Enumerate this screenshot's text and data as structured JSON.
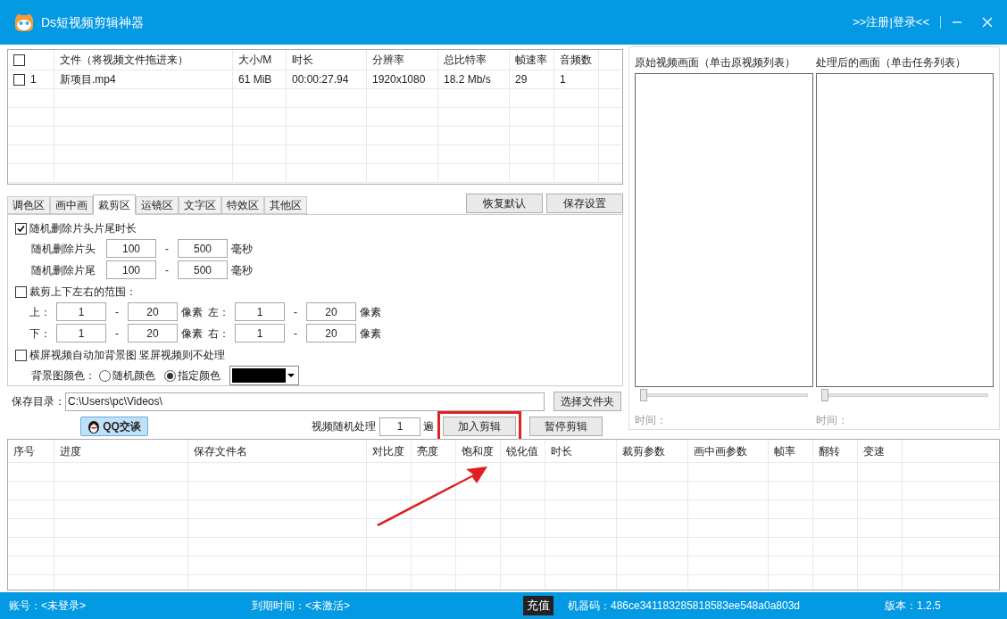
{
  "window": {
    "title": "Ds短视频剪辑神器",
    "login_link": ">>注册|登录<<"
  },
  "file_table": {
    "header_checked": false,
    "columns": [
      "文件（将视频文件拖进来）",
      "大小/M",
      "时长",
      "分辨率",
      "总比特率",
      "帧速率",
      "音频数"
    ],
    "rows": [
      {
        "checked": false,
        "index": "1",
        "cells": [
          "新项目.mp4",
          "61 MiB",
          "00:00:27.94",
          "1920x1080",
          "18.2 Mb/s",
          "29",
          "1"
        ]
      }
    ]
  },
  "tabs": [
    {
      "label": "调色区",
      "selected": false
    },
    {
      "label": "画中画",
      "selected": false
    },
    {
      "label": "裁剪区",
      "selected": true
    },
    {
      "label": "运镜区",
      "selected": false
    },
    {
      "label": "文字区",
      "selected": false
    },
    {
      "label": "特效区",
      "selected": false
    },
    {
      "label": "其他区",
      "selected": false
    }
  ],
  "tab_buttons": [
    "恢复默认",
    "保存设置"
  ],
  "random_trim": {
    "label": "随机删除片头片尾时长",
    "checked": true,
    "rows": [
      {
        "label": "随机删除片头",
        "from": "100",
        "sep": "-",
        "to": "500",
        "unit": "毫秒"
      },
      {
        "label": "随机删除片尾",
        "from": "100",
        "sep": "-",
        "to": "500",
        "unit": "毫秒"
      }
    ]
  },
  "crop_range": {
    "label": "裁剪上下左右的范围：",
    "checked": false,
    "rows": [
      [
        {
          "label": "上：",
          "from": "1",
          "sep": "-",
          "to": "20",
          "unit": "像素"
        },
        {
          "label": "左：",
          "from": "1",
          "sep": "-",
          "to": "20",
          "unit": "像素"
        }
      ],
      [
        {
          "label": "下：",
          "from": "1",
          "sep": "-",
          "to": "20",
          "unit": "像素"
        },
        {
          "label": "右：",
          "from": "1",
          "sep": "-",
          "to": "20",
          "unit": "像素"
        }
      ]
    ]
  },
  "background": {
    "label": "横屏视频自动加背景图 竖屏视频则不处理",
    "checked": false,
    "color_label": "背景图颜色：",
    "options": [
      {
        "label": "随机颜色",
        "selected": false
      },
      {
        "label": "指定颜色",
        "selected": true
      }
    ]
  },
  "save_dir": {
    "label": "保存目录：",
    "value": "C:\\Users\\pc\\Videos\\",
    "button": "选择文件夹"
  },
  "qq_button": "QQ交谈",
  "random_process": {
    "label": "视频随机处理",
    "value": "1",
    "unit": "遍"
  },
  "actions": [
    {
      "label": "加入剪辑",
      "highlighted": true
    },
    {
      "label": "暂停剪辑",
      "highlighted": false
    }
  ],
  "task_table": {
    "columns": [
      "序号",
      "进度",
      "保存文件名",
      "对比度",
      "亮度",
      "饱和度",
      "锐化值",
      "时长",
      "裁剪参数",
      "画中画参数",
      "帧率",
      "翻转",
      "变速"
    ]
  },
  "previews": [
    {
      "title": "原始视频画面（单击原视频列表）",
      "level": 0,
      "time_label": "时间："
    },
    {
      "title": "处理后的画面（单击任务列表）",
      "level": 0,
      "time_label": "时间："
    }
  ],
  "status_bar": {
    "account": "账号：<未登录>",
    "expiry": "到期时间：<未激活>",
    "recharge": "充值",
    "machine_code": "机器码：486ce341183285818583ee548a0a803d",
    "version": "版本：1.2.5"
  }
}
